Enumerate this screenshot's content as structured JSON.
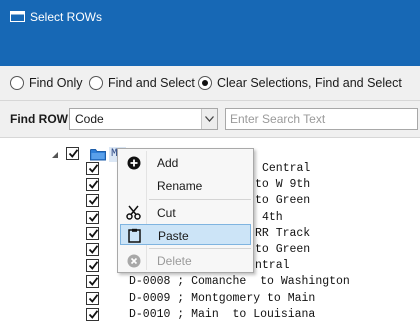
{
  "window": {
    "title": "Select ROWs",
    "title_icon": "window-icon"
  },
  "options": {
    "radios": [
      {
        "label": "Find Only",
        "checked": false
      },
      {
        "label": "Find and Select",
        "checked": false
      },
      {
        "label": "Clear Selections, Find and Select",
        "checked": true
      }
    ]
  },
  "find": {
    "label": "Find ROW",
    "field_value": "Code",
    "search_placeholder": "Enter Search Text"
  },
  "tree": {
    "root": {
      "label": "Ma",
      "checked": true,
      "expanded": true,
      "icon": "folder-icon"
    },
    "rows": [
      {
        "label": "Central",
        "checked": true
      },
      {
        "label": "to W 9th",
        "checked": true
      },
      {
        "label": "to Green",
        "checked": true
      },
      {
        "label": "4th",
        "checked": true
      },
      {
        "label": "RR Track",
        "checked": true
      },
      {
        "label": "to Green",
        "checked": true
      },
      {
        "label": "ntral",
        "checked": true
      },
      {
        "label": "D-0008 ; Comanche  to Washington",
        "checked": true
      },
      {
        "label": "D-0009 ; Montgomery to Main",
        "checked": true
      },
      {
        "label": "D-0010 ; Main  to Louisiana",
        "checked": true
      }
    ]
  },
  "context_menu": {
    "items": [
      {
        "label": "Add",
        "icon": "add-icon",
        "enabled": true,
        "highlighted": false
      },
      {
        "label": "Rename",
        "icon": "",
        "enabled": true,
        "highlighted": false
      },
      {
        "label": "Cut",
        "icon": "scissors-icon",
        "enabled": true,
        "highlighted": false
      },
      {
        "label": "Paste",
        "icon": "clipboard-icon",
        "enabled": true,
        "highlighted": true
      },
      {
        "label": "Delete",
        "icon": "delete-icon",
        "enabled": false,
        "highlighted": false
      }
    ]
  },
  "colors": {
    "titlebar": "#1768b5",
    "highlight": "#cce4f7",
    "folder": "#2f7fd8"
  }
}
